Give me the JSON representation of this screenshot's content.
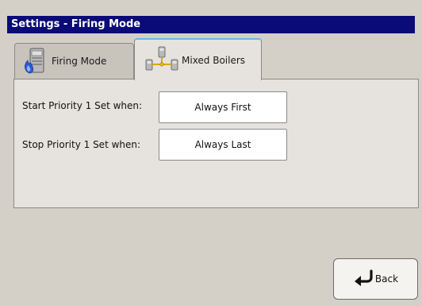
{
  "window": {
    "title": "Settings - Firing Mode"
  },
  "tabs": [
    {
      "label": "Firing Mode",
      "icon": "boiler-flame-icon",
      "selected": false
    },
    {
      "label": "Mixed Boilers",
      "icon": "mixed-boilers-icon",
      "selected": true
    }
  ],
  "settings": {
    "start_label": "Start Priority 1 Set when:",
    "start_value": "Always First",
    "stop_label": "Stop Priority 1 Set when:",
    "stop_value": "Always Last"
  },
  "footer": {
    "back_label": "Back",
    "back_icon": "back-arrow-icon"
  },
  "colors": {
    "title_bar": "#0a0a78",
    "background": "#d4d0c8",
    "panel": "#e6e3de",
    "selected_tab_accent": "#6fb6e8",
    "flame": "#2a5bd7"
  }
}
